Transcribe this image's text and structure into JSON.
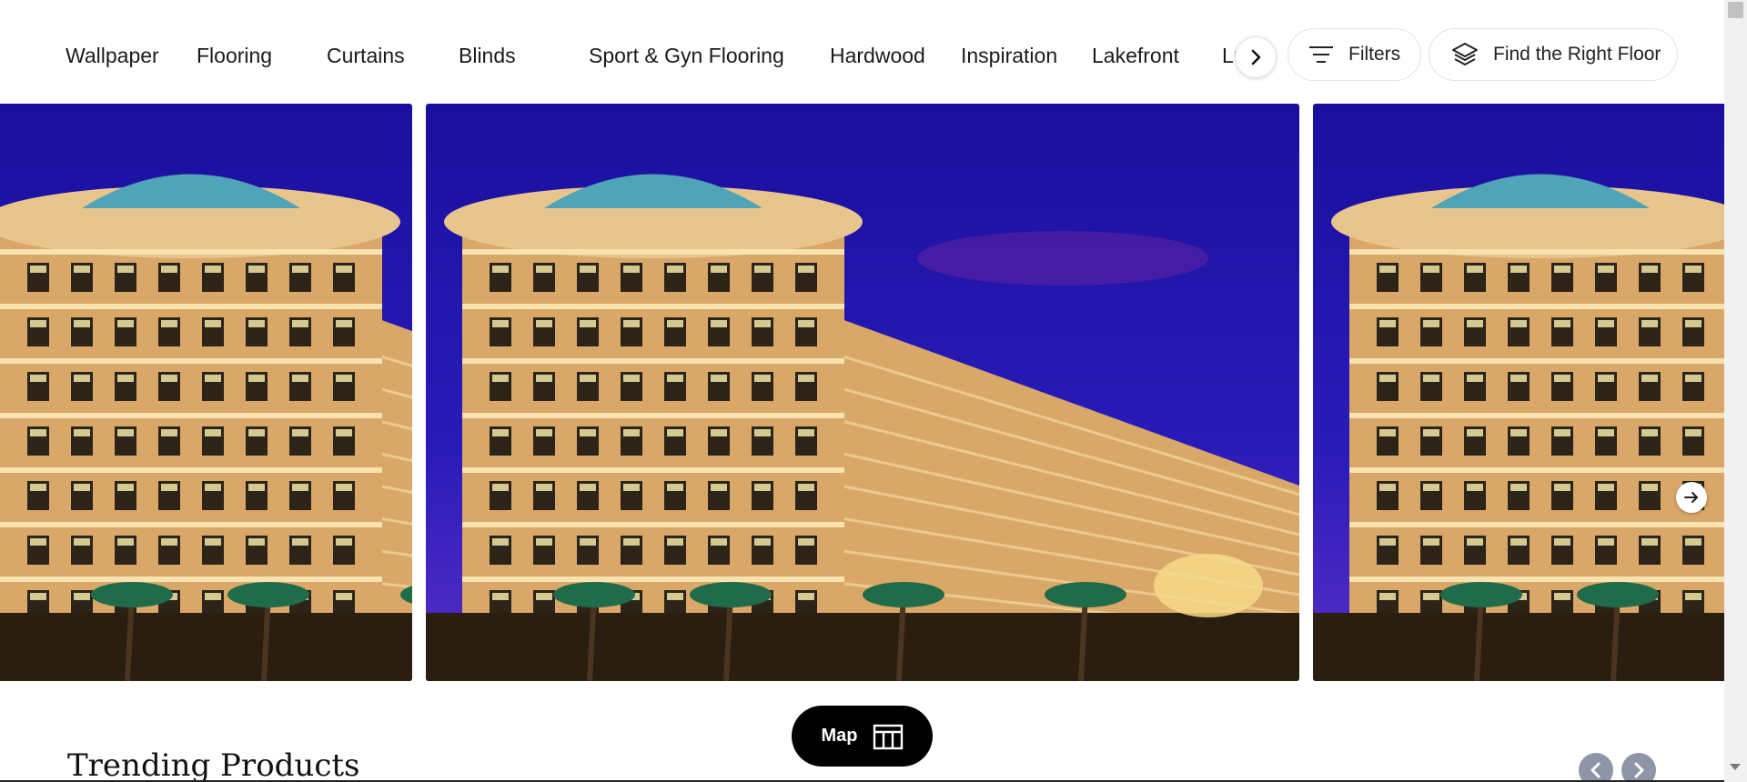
{
  "categories": [
    {
      "label": "Wallpaper"
    },
    {
      "label": "Flooring"
    },
    {
      "label": "Curtains"
    },
    {
      "label": "Blinds"
    },
    {
      "label": "Sport & Gyn Flooring"
    },
    {
      "label": "Hardwood"
    },
    {
      "label": "Inspiration"
    },
    {
      "label": "Lakefront"
    },
    {
      "label": "Lu"
    }
  ],
  "toolbar": {
    "filters_label": "Filters",
    "find_floor_label": "Find the Right Floor"
  },
  "carousel": {
    "slide_count": 3,
    "sky_color": "#2a1bb8",
    "building_color": "#d9a868"
  },
  "map_button": {
    "label": "Map"
  },
  "trending": {
    "title": "Trending Products"
  },
  "icons": {
    "category_next": "chevron-right-icon",
    "filters": "filter-lines-icon",
    "find_floor": "layers-icon",
    "carousel_next": "arrow-right-circle-icon",
    "map": "building-map-icon",
    "trend_prev": "chevron-left-icon",
    "trend_next": "chevron-right-icon"
  }
}
